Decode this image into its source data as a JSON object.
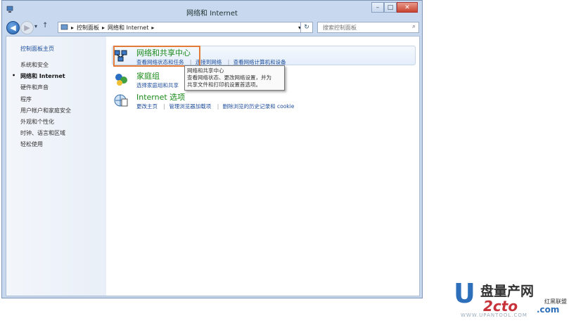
{
  "window": {
    "title": "网络和 Internet",
    "controls": {
      "minimize": "–",
      "maximize": "□",
      "close": "✕"
    }
  },
  "nav": {
    "back_icon": "◀",
    "forward_icon": "▶",
    "up_icon": "↑",
    "breadcrumb": [
      "控制面板",
      "网络和 Internet"
    ],
    "breadcrumb_sep": "▸",
    "search_placeholder": "搜索控制面板",
    "refresh_icon": "↻"
  },
  "sidebar": {
    "items": [
      {
        "label": "控制面板主页"
      },
      {
        "label": "系统和安全"
      },
      {
        "label": "网络和 Internet",
        "bullet": "•"
      },
      {
        "label": "硬件和声音"
      },
      {
        "label": "程序"
      },
      {
        "label": "用户帐户和家庭安全"
      },
      {
        "label": "外观和个性化"
      },
      {
        "label": "时钟、语言和区域"
      },
      {
        "label": "轻松使用"
      }
    ]
  },
  "categories": [
    {
      "title": "网络和共享中心",
      "links": [
        "查看网络状态和任务",
        "连接到网络",
        "查看网络计算机和设备"
      ]
    },
    {
      "title": "家庭组",
      "links": [
        "选择家庭组和共享"
      ]
    },
    {
      "title": "Internet 选项",
      "links": [
        "更改主页",
        "管理浏览器加载项",
        "删除浏览的历史记录和 cookie"
      ]
    }
  ],
  "tooltip": {
    "lines": [
      "网络和共享中心",
      "查看网络状态、更改网络设置，并为",
      "共享文件和打印机设置首选项。"
    ]
  },
  "watermark": {
    "letter": "U",
    "brand": "盘量产网",
    "logo": "2cto",
    "suffix": ".com",
    "sub": "红黑联盟",
    "url": "WWW.UPANTOOL.COM"
  },
  "colors": {
    "accent": "#1e4d9b",
    "category_title": "#1a8a1a",
    "highlight_border": "#e27b37"
  }
}
